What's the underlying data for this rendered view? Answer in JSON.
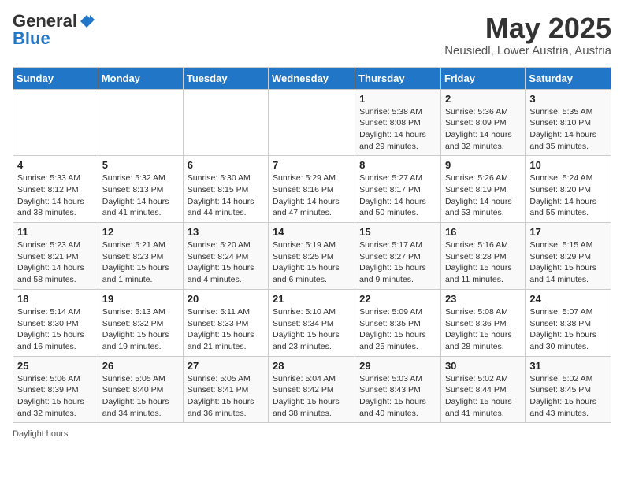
{
  "logo": {
    "general": "General",
    "blue": "Blue"
  },
  "title": "May 2025",
  "subtitle": "Neusiedl, Lower Austria, Austria",
  "days_of_week": [
    "Sunday",
    "Monday",
    "Tuesday",
    "Wednesday",
    "Thursday",
    "Friday",
    "Saturday"
  ],
  "footer_label": "Daylight hours",
  "weeks": [
    [
      {
        "num": "",
        "info": ""
      },
      {
        "num": "",
        "info": ""
      },
      {
        "num": "",
        "info": ""
      },
      {
        "num": "",
        "info": ""
      },
      {
        "num": "1",
        "info": "Sunrise: 5:38 AM\nSunset: 8:08 PM\nDaylight: 14 hours\nand 29 minutes."
      },
      {
        "num": "2",
        "info": "Sunrise: 5:36 AM\nSunset: 8:09 PM\nDaylight: 14 hours\nand 32 minutes."
      },
      {
        "num": "3",
        "info": "Sunrise: 5:35 AM\nSunset: 8:10 PM\nDaylight: 14 hours\nand 35 minutes."
      }
    ],
    [
      {
        "num": "4",
        "info": "Sunrise: 5:33 AM\nSunset: 8:12 PM\nDaylight: 14 hours\nand 38 minutes."
      },
      {
        "num": "5",
        "info": "Sunrise: 5:32 AM\nSunset: 8:13 PM\nDaylight: 14 hours\nand 41 minutes."
      },
      {
        "num": "6",
        "info": "Sunrise: 5:30 AM\nSunset: 8:15 PM\nDaylight: 14 hours\nand 44 minutes."
      },
      {
        "num": "7",
        "info": "Sunrise: 5:29 AM\nSunset: 8:16 PM\nDaylight: 14 hours\nand 47 minutes."
      },
      {
        "num": "8",
        "info": "Sunrise: 5:27 AM\nSunset: 8:17 PM\nDaylight: 14 hours\nand 50 minutes."
      },
      {
        "num": "9",
        "info": "Sunrise: 5:26 AM\nSunset: 8:19 PM\nDaylight: 14 hours\nand 53 minutes."
      },
      {
        "num": "10",
        "info": "Sunrise: 5:24 AM\nSunset: 8:20 PM\nDaylight: 14 hours\nand 55 minutes."
      }
    ],
    [
      {
        "num": "11",
        "info": "Sunrise: 5:23 AM\nSunset: 8:21 PM\nDaylight: 14 hours\nand 58 minutes."
      },
      {
        "num": "12",
        "info": "Sunrise: 5:21 AM\nSunset: 8:23 PM\nDaylight: 15 hours\nand 1 minute."
      },
      {
        "num": "13",
        "info": "Sunrise: 5:20 AM\nSunset: 8:24 PM\nDaylight: 15 hours\nand 4 minutes."
      },
      {
        "num": "14",
        "info": "Sunrise: 5:19 AM\nSunset: 8:25 PM\nDaylight: 15 hours\nand 6 minutes."
      },
      {
        "num": "15",
        "info": "Sunrise: 5:17 AM\nSunset: 8:27 PM\nDaylight: 15 hours\nand 9 minutes."
      },
      {
        "num": "16",
        "info": "Sunrise: 5:16 AM\nSunset: 8:28 PM\nDaylight: 15 hours\nand 11 minutes."
      },
      {
        "num": "17",
        "info": "Sunrise: 5:15 AM\nSunset: 8:29 PM\nDaylight: 15 hours\nand 14 minutes."
      }
    ],
    [
      {
        "num": "18",
        "info": "Sunrise: 5:14 AM\nSunset: 8:30 PM\nDaylight: 15 hours\nand 16 minutes."
      },
      {
        "num": "19",
        "info": "Sunrise: 5:13 AM\nSunset: 8:32 PM\nDaylight: 15 hours\nand 19 minutes."
      },
      {
        "num": "20",
        "info": "Sunrise: 5:11 AM\nSunset: 8:33 PM\nDaylight: 15 hours\nand 21 minutes."
      },
      {
        "num": "21",
        "info": "Sunrise: 5:10 AM\nSunset: 8:34 PM\nDaylight: 15 hours\nand 23 minutes."
      },
      {
        "num": "22",
        "info": "Sunrise: 5:09 AM\nSunset: 8:35 PM\nDaylight: 15 hours\nand 25 minutes."
      },
      {
        "num": "23",
        "info": "Sunrise: 5:08 AM\nSunset: 8:36 PM\nDaylight: 15 hours\nand 28 minutes."
      },
      {
        "num": "24",
        "info": "Sunrise: 5:07 AM\nSunset: 8:38 PM\nDaylight: 15 hours\nand 30 minutes."
      }
    ],
    [
      {
        "num": "25",
        "info": "Sunrise: 5:06 AM\nSunset: 8:39 PM\nDaylight: 15 hours\nand 32 minutes."
      },
      {
        "num": "26",
        "info": "Sunrise: 5:05 AM\nSunset: 8:40 PM\nDaylight: 15 hours\nand 34 minutes."
      },
      {
        "num": "27",
        "info": "Sunrise: 5:05 AM\nSunset: 8:41 PM\nDaylight: 15 hours\nand 36 minutes."
      },
      {
        "num": "28",
        "info": "Sunrise: 5:04 AM\nSunset: 8:42 PM\nDaylight: 15 hours\nand 38 minutes."
      },
      {
        "num": "29",
        "info": "Sunrise: 5:03 AM\nSunset: 8:43 PM\nDaylight: 15 hours\nand 40 minutes."
      },
      {
        "num": "30",
        "info": "Sunrise: 5:02 AM\nSunset: 8:44 PM\nDaylight: 15 hours\nand 41 minutes."
      },
      {
        "num": "31",
        "info": "Sunrise: 5:02 AM\nSunset: 8:45 PM\nDaylight: 15 hours\nand 43 minutes."
      }
    ]
  ]
}
